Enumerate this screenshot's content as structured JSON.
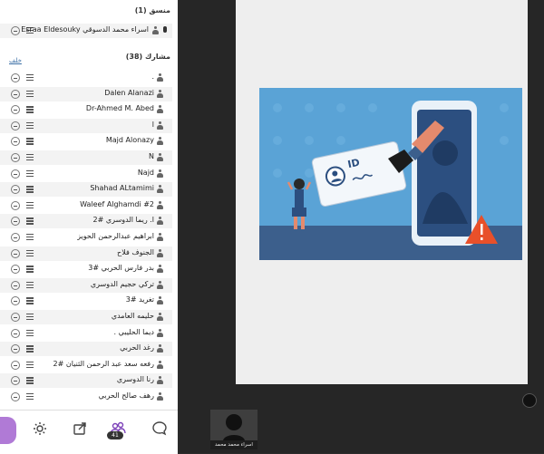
{
  "sidebar": {
    "coordinator_header": "منسق (1)",
    "coordinator": {
      "name": "اسراء محمد الدسوقي Esraa Eldesouky"
    },
    "participants_header": "مشارك (38)",
    "clip_label": "خلف",
    "participants": [
      {
        "name": "."
      },
      {
        "name": "Dalen Alanazi"
      },
      {
        "name": "Dr-Ahmed M. Abed"
      },
      {
        "name": "l"
      },
      {
        "name": "Majd Alonazy"
      },
      {
        "name": "N"
      },
      {
        "name": "Najd"
      },
      {
        "name": "Shahad ALtamimi"
      },
      {
        "name": "Waleef Alghamdi #2"
      },
      {
        "name": "ا. ريما الدوسري #2"
      },
      {
        "name": "ابراهيم عبدالرحمن الحويز"
      },
      {
        "name": "الجنوف فلاح"
      },
      {
        "name": "بدر فارس الحربي #3"
      },
      {
        "name": "تركي حجيم الدوسري"
      },
      {
        "name": "تغريد #3"
      },
      {
        "name": "حليمه العامدي"
      },
      {
        "name": "ديما الحليبي ."
      },
      {
        "name": "رغد الحربي"
      },
      {
        "name": "رفعه سعد عبد الرحمن الثنيان #2"
      },
      {
        "name": "رنا الدوسري"
      },
      {
        "name": "رهف صالح الحربي"
      }
    ]
  },
  "toolbar": {
    "items": [
      {
        "icon": "gear-icon"
      },
      {
        "icon": "share-icon"
      },
      {
        "icon": "participants-icon"
      },
      {
        "icon": "chat-icon"
      }
    ],
    "participants_count": "41"
  },
  "slide": {
    "id_card_text": "ID"
  },
  "thumbnail": {
    "name": "اسراء محمد محمد"
  },
  "colors": {
    "slide_bg": "#5aa3d6",
    "warning": "#e8502a",
    "accent": "#b07ad6"
  }
}
